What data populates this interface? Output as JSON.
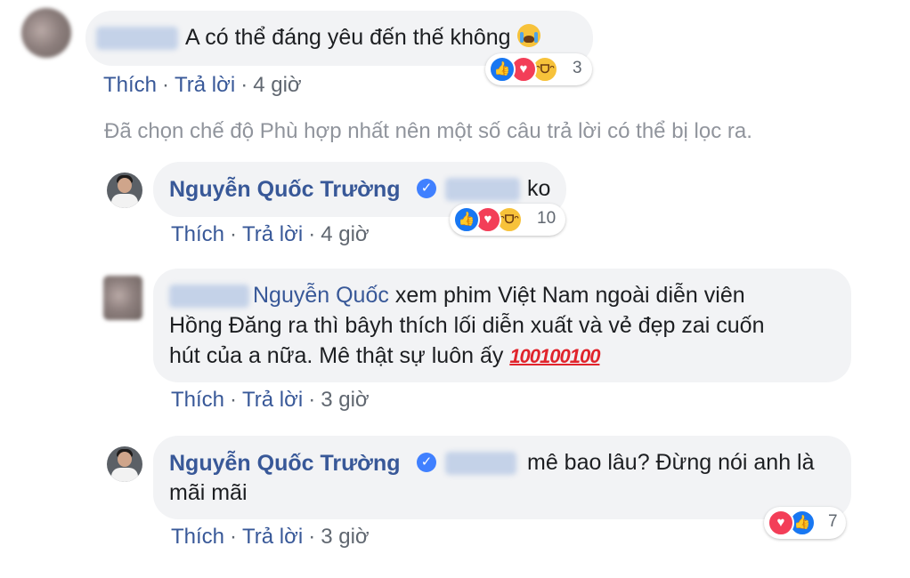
{
  "comments": [
    {
      "text": "A có thể đáng yêu đến thế không",
      "emoji": "loudly-crying-face",
      "reaction_count": "3",
      "actions": {
        "like": "Thích",
        "reply": "Trả lời",
        "time": "4 giờ"
      }
    }
  ],
  "filter_notice": "Đã chọn chế độ Phù hợp nhất nên một số câu trả lời có thể bị lọc ra.",
  "replies": [
    {
      "author": "Nguyễn Quốc Trường",
      "text": "ko",
      "reaction_count": "10",
      "actions": {
        "like": "Thích",
        "reply": "Trả lời",
        "time": "4 giờ"
      }
    },
    {
      "mention": "Nguyễn Quốc",
      "text_line1": "xem phim Việt Nam ngoài diễn viên",
      "text_line2": "Hồng Đăng ra thì bâyh thích lối diễn xuất và vẻ đẹp zai cuốn",
      "text_line3": "hút của a nữa. Mê thật sự luôn ấy",
      "emoji_text": "💯💯💯",
      "actions": {
        "like": "Thích",
        "reply": "Trả lời",
        "time": "3 giờ"
      }
    },
    {
      "author": "Nguyễn Quốc Trường",
      "text_line1": "mê bao lâu? Đừng nói anh là",
      "text_line2": "mãi mãi",
      "reaction_count": "7",
      "actions": {
        "like": "Thích",
        "reply": "Trả lời",
        "time": "3 giờ"
      }
    }
  ],
  "reaction_icons": {
    "like": "👍",
    "love": "♥",
    "haha": "ᵔᗜᵔ"
  },
  "colors": {
    "link": "#385898",
    "bubble": "#f2f3f5",
    "meta": "#606770",
    "notice": "#90949c"
  }
}
